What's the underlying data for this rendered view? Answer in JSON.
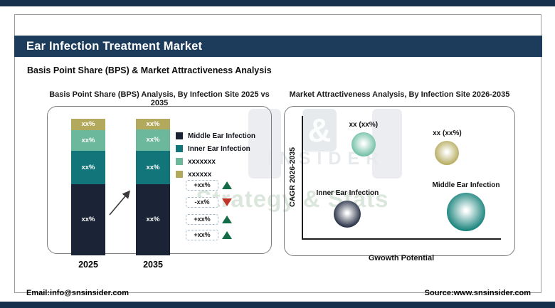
{
  "header": {
    "title": "Ear Infection Treatment Market",
    "subtitle": "Basis Point Share (BPS) & Market Attractiveness Analysis"
  },
  "watermark": {
    "symbol": "&",
    "name": "INSIDER",
    "tagline": "Strategy & Stats"
  },
  "footer": {
    "email": "Email:info@snsinsider.com",
    "source": "Source:www.snsinsider.com"
  },
  "colors": {
    "accent_navy": "#1d3b5a",
    "strip_navy": "#14304d",
    "middle_ear_navy": "#1b2436",
    "inner_ear_teal": "#127579",
    "series3_light_teal": "#6cb89d",
    "series4_olive": "#b3a95c",
    "up_green": "#146c46",
    "down_red": "#c13328"
  },
  "chart_data": [
    {
      "type": "bar",
      "stacked": true,
      "title": "Basis Point Share (BPS) Analysis, By Infection Site 2025 vs 2035",
      "categories": [
        "2025",
        "2035"
      ],
      "value_note": "all segment values masked as xx%",
      "stack_top_to_bottom": [
        {
          "name": "xxxxxx",
          "color": "#b3a95c",
          "value_label": "xx%",
          "share_pct": [
            8.3,
            7.8
          ]
        },
        {
          "name": "xxxxxxx",
          "color": "#6cb89d",
          "value_label": "xx%",
          "share_pct": [
            15.1,
            15.6
          ]
        },
        {
          "name": "Inner Ear Infection",
          "color": "#127579",
          "value_label": "xx%",
          "share_pct": [
            24.5,
            24.5
          ]
        },
        {
          "name": "Middle Ear Infection",
          "color": "#1b2436",
          "value_label": "xx%",
          "share_pct": [
            52.1,
            52.1
          ]
        }
      ],
      "legend": [
        {
          "label": "Middle Ear Infection",
          "color": "#1b2436"
        },
        {
          "label": "Inner Ear Infection",
          "color": "#127579"
        },
        {
          "label": "xxxxxxx",
          "color": "#6cb89d"
        },
        {
          "label": "xxxxxx",
          "color": "#b3a95c"
        }
      ],
      "bps_changes": [
        {
          "value": "+xx%",
          "direction": "up"
        },
        {
          "value": "-xx%",
          "direction": "down"
        },
        {
          "value": "+xx%",
          "direction": "up"
        },
        {
          "value": "+xx%",
          "direction": "up"
        }
      ]
    },
    {
      "type": "scatter",
      "title": "Market Attractiveness Analysis, By Infection Site 2026-2035",
      "xlabel": "Gwowth Potential",
      "ylabel": "CAGR 2026-2035",
      "x_range": [
        0,
        1
      ],
      "y_range": [
        0,
        1
      ],
      "bubbles": [
        {
          "label": "xx (xx%)",
          "color": "#6fbfa3",
          "x": 0.31,
          "y": 0.77,
          "r": 17
        },
        {
          "label": "xx (xx%)",
          "color": "#b5ab5e",
          "x": 0.73,
          "y": 0.7,
          "r": 17
        },
        {
          "label": "Inner Ear Infection",
          "color": "#232c42",
          "x": 0.23,
          "y": 0.2,
          "r": 19
        },
        {
          "label": "Middle Ear Infection",
          "color": "#17827b",
          "x": 0.825,
          "y": 0.215,
          "r": 27
        }
      ]
    }
  ]
}
